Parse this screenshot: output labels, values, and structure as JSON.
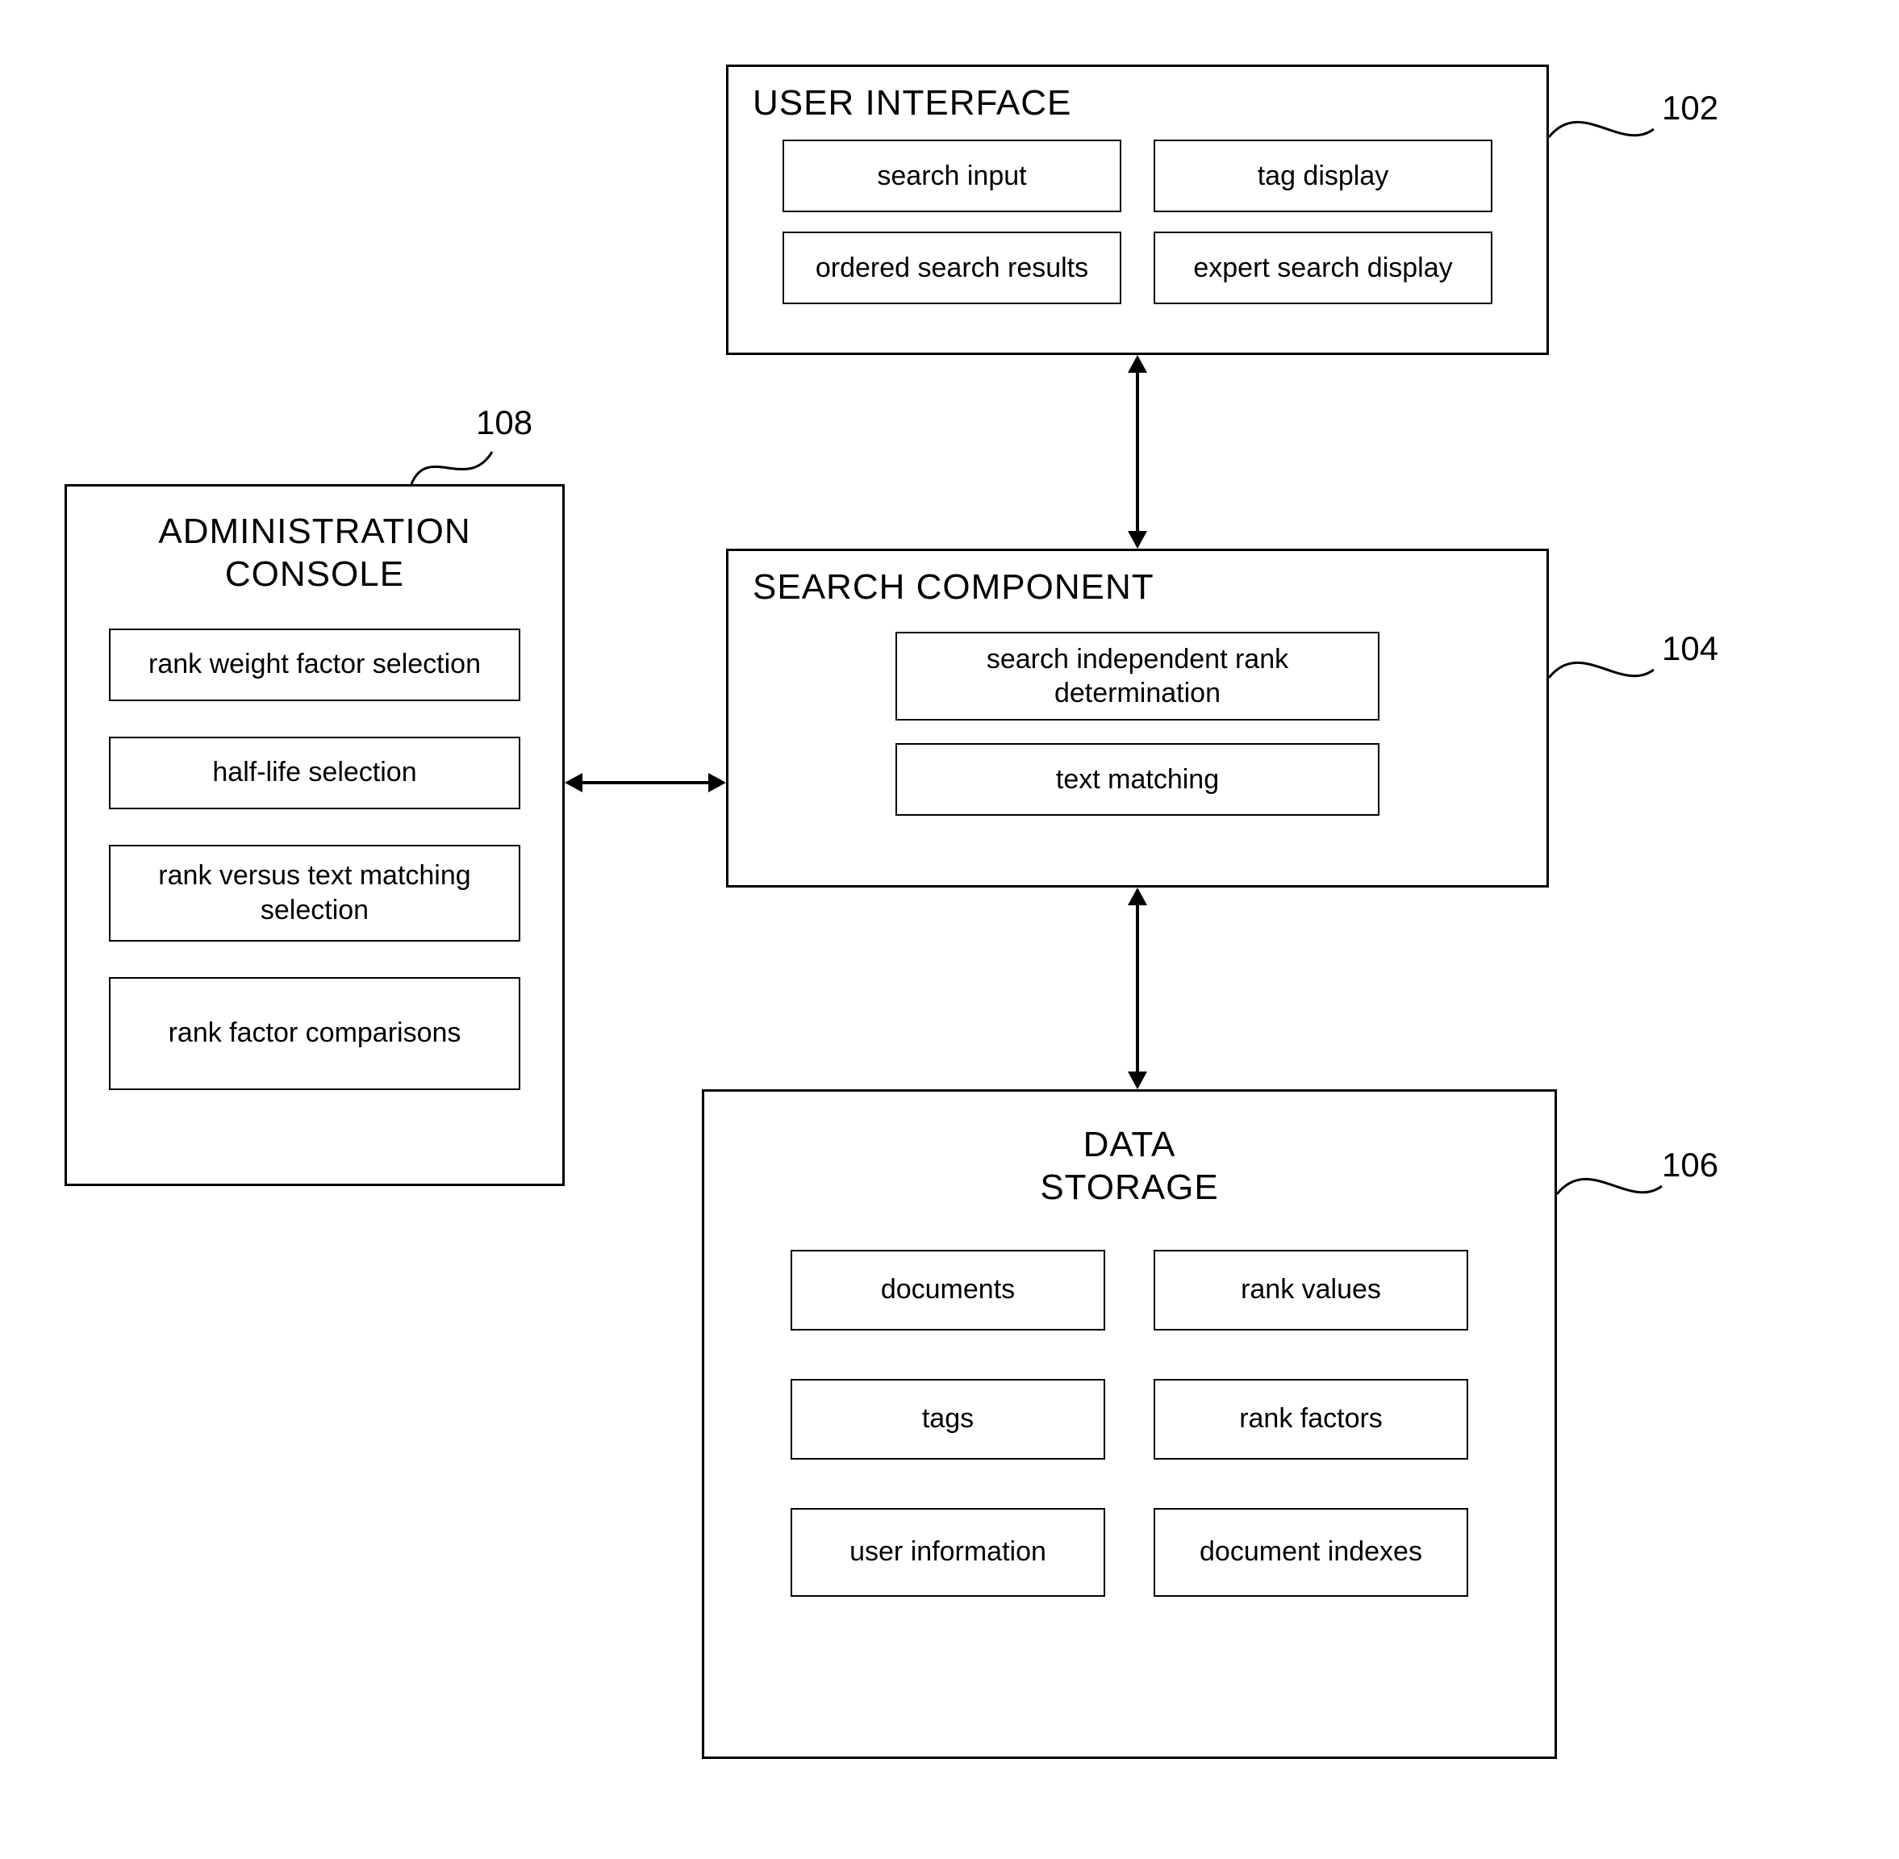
{
  "user_interface": {
    "title": "USER INTERFACE",
    "ref": "102",
    "items": {
      "search_input": "search input",
      "tag_display": "tag display",
      "ordered_search_results": "ordered search results",
      "expert_search_display": "expert search display"
    }
  },
  "search_component": {
    "title": "SEARCH COMPONENT",
    "ref": "104",
    "items": {
      "sird": "search independent rank determination",
      "text_matching": "text matching"
    }
  },
  "data_storage": {
    "title": "DATA STORAGE",
    "ref": "106",
    "items": {
      "documents": "documents",
      "rank_values": "rank values",
      "tags": "tags",
      "rank_factors": "rank factors",
      "user_information": "user information",
      "document_indexes": "document indexes"
    }
  },
  "admin_console": {
    "title": "ADMINISTRATION CONSOLE",
    "ref": "108",
    "items": {
      "rank_weight": "rank weight factor selection",
      "half_life": "half-life selection",
      "rank_vs_text": "rank versus text matching selection",
      "rank_comparisons": "rank factor comparisons"
    }
  }
}
